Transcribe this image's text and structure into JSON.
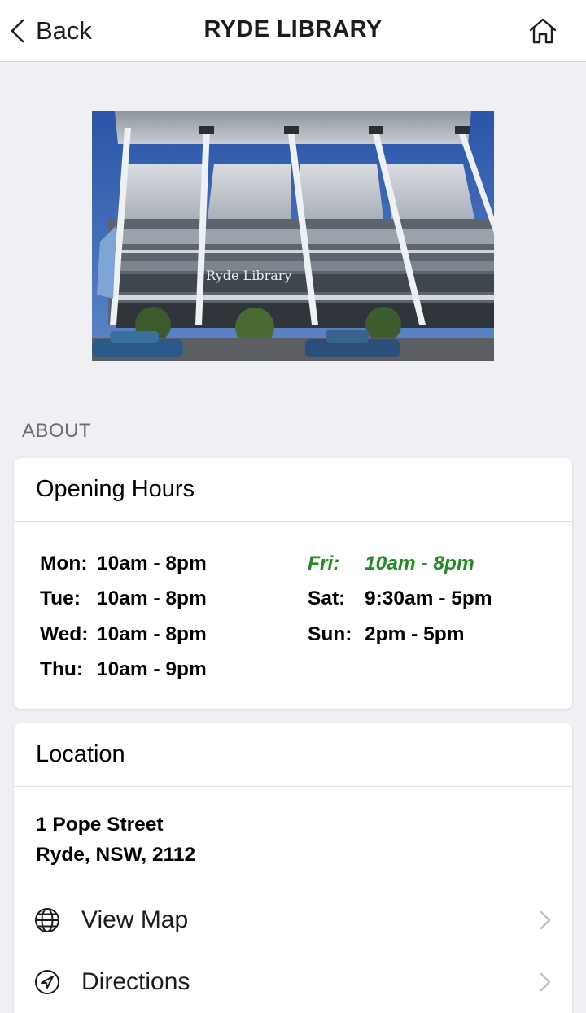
{
  "nav": {
    "back_label": "Back",
    "title": "RYDE LIBRARY",
    "icons": {
      "back": "chevron-left-icon",
      "home": "home-icon"
    }
  },
  "photo": {
    "caption": "Ryde Library"
  },
  "about": {
    "section_header": "ABOUT"
  },
  "hours": {
    "title": "Opening Hours",
    "highlight_color": "#228b22",
    "left": [
      {
        "day": "Mon:",
        "time": "10am - 8pm"
      },
      {
        "day": "Tue:",
        "time": "10am - 8pm"
      },
      {
        "day": "Wed:",
        "time": "10am - 8pm"
      },
      {
        "day": "Thu:",
        "time": "10am - 9pm"
      }
    ],
    "right": [
      {
        "day": "Fri:",
        "time": "10am - 8pm",
        "today": true
      },
      {
        "day": "Sat:",
        "time": "9:30am - 5pm"
      },
      {
        "day": "Sun:",
        "time": "2pm - 5pm"
      }
    ]
  },
  "location": {
    "title": "Location",
    "address_line1": "1 Pope Street",
    "address_line2": "Ryde, NSW, 2112",
    "view_map_label": "View Map",
    "directions_label": "Directions",
    "icons": {
      "view_map": "globe-icon",
      "directions": "compass-arrow-icon",
      "chevron": "chevron-right-icon"
    }
  }
}
